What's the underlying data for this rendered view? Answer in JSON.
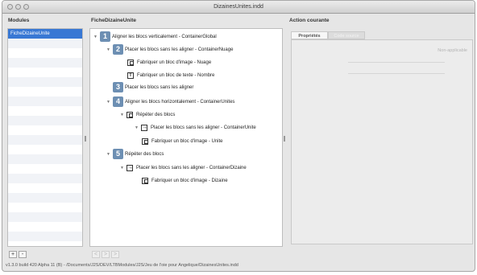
{
  "window": {
    "title": "DizainesUnites.indd"
  },
  "modules": {
    "header": "Modules",
    "items": [
      "FicheDizaineUnite"
    ],
    "add_label": "+",
    "remove_label": "-"
  },
  "main": {
    "header": "FicheDizaineUnite",
    "nav_buttons": [
      "<",
      ">",
      ">"
    ]
  },
  "tree": [
    {
      "step": "1",
      "icon": "",
      "label": "Aligner les blocs verticalement  - ContainerGlobal",
      "expand": "▼"
    },
    {
      "step": "2",
      "icon": "",
      "label": "Placer les blocs sans les aligner  - ContainerNuage",
      "expand": "▼"
    },
    {
      "step": "",
      "icon": "image",
      "label": "Fabriquer un bloc d'image - Nuage",
      "expand": ""
    },
    {
      "step": "",
      "icon": "text",
      "label": "Fabriquer un bloc de texte - Nombre",
      "expand": ""
    },
    {
      "step": "3",
      "icon": "",
      "label": "Placer les blocs sans les aligner",
      "expand": ""
    },
    {
      "step": "4",
      "icon": "",
      "label": "Aligner les blocs horizontalement  - ContainerUnites",
      "expand": "▼"
    },
    {
      "step": "",
      "icon": "image",
      "label": "Répéter des blocs",
      "expand": "▼"
    },
    {
      "step": "",
      "icon": "arrow",
      "label": "Placer les blocs sans les aligner  - ContainerUnite",
      "expand": "▼"
    },
    {
      "step": "",
      "icon": "image",
      "label": "Fabriquer un bloc d'image - Unite",
      "expand": ""
    },
    {
      "step": "5",
      "icon": "",
      "label": "Répéter des blocs",
      "expand": "▼"
    },
    {
      "step": "",
      "icon": "arrow",
      "label": "Placer les blocs sans les aligner  - ContainerDizaine",
      "expand": "▼"
    },
    {
      "step": "",
      "icon": "image",
      "label": "Fabriquer un bloc d'image - Dizaine",
      "expand": ""
    }
  ],
  "action": {
    "header": "Action courante",
    "tabs": [
      "Propriétés",
      "Code source"
    ],
    "status": "Non-applicable"
  },
  "statusbar": {
    "text": "v1.3.0 build 420 Alpha 11 (B) - /Documents/J2S/DEV/LTBModules/J2S/Jeu de l'oie pour Angelique/DizainesUnites.indd"
  },
  "colors": {
    "selection": "#3878d4",
    "step_badge": "#6d8fb3"
  }
}
